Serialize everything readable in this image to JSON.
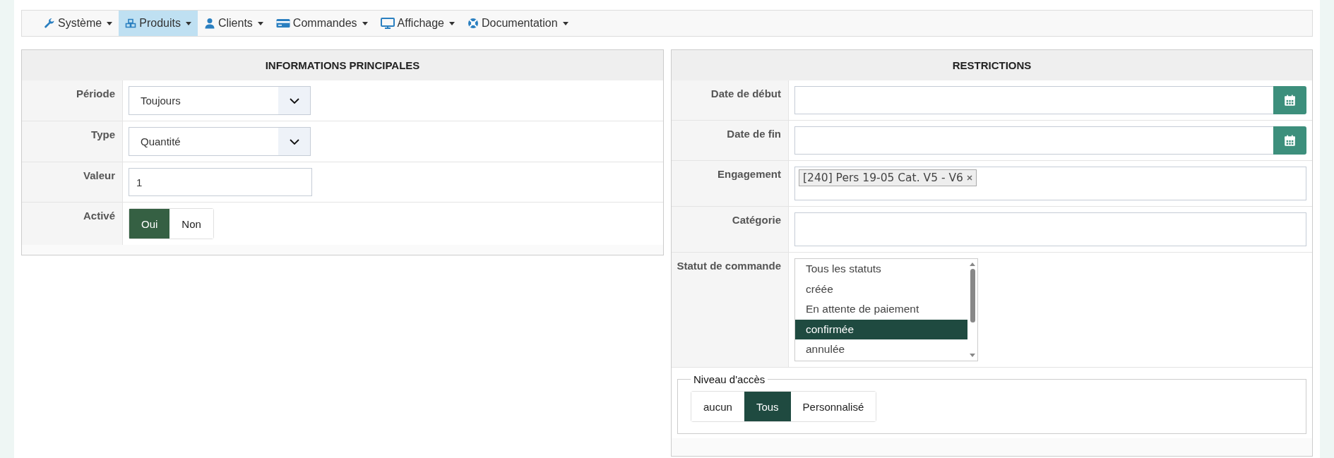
{
  "nav": [
    {
      "label": "Système",
      "selected": false
    },
    {
      "label": "Produits",
      "selected": true
    },
    {
      "label": "Clients",
      "selected": false
    },
    {
      "label": "Commandes",
      "selected": false
    },
    {
      "label": "Affichage",
      "selected": false
    },
    {
      "label": "Documentation",
      "selected": false
    }
  ],
  "main_info": {
    "title": "INFORMATIONS PRINCIPALES",
    "rows": [
      {
        "label": "Période",
        "kind": "select",
        "value": "Toujours"
      },
      {
        "label": "Type",
        "kind": "select",
        "value": "Quantité"
      },
      {
        "label": "Valeur",
        "kind": "input",
        "value": "1"
      },
      {
        "label": "Activé",
        "kind": "toggle",
        "options": [
          {
            "label": "Oui",
            "selected": true
          },
          {
            "label": "Non",
            "selected": false
          }
        ]
      }
    ]
  },
  "restrictions": {
    "title": "RESTRICTIONS",
    "rows": [
      {
        "label": "Date de début",
        "kind": "date"
      },
      {
        "label": "Date de fin",
        "kind": "date"
      },
      {
        "label": "Engagement",
        "kind": "tags",
        "tags": [
          "[240] Pers 19-05 Cat. V5 - V6"
        ]
      },
      {
        "label": "Catégorie",
        "kind": "text"
      },
      {
        "label": "Statut de commande",
        "kind": "listbox",
        "items": [
          {
            "label": "Tous les statuts",
            "selected": false
          },
          {
            "label": "créée",
            "selected": false
          },
          {
            "label": "En attente de paiement",
            "selected": false
          },
          {
            "label": "confirmée",
            "selected": true
          },
          {
            "label": "annulée",
            "selected": false
          }
        ]
      }
    ],
    "access": {
      "legend": "Niveau d'accès",
      "options": [
        {
          "label": "aucun",
          "selected": false
        },
        {
          "label": "Tous",
          "selected": true
        },
        {
          "label": "Personnalisé",
          "selected": false
        }
      ]
    }
  }
}
